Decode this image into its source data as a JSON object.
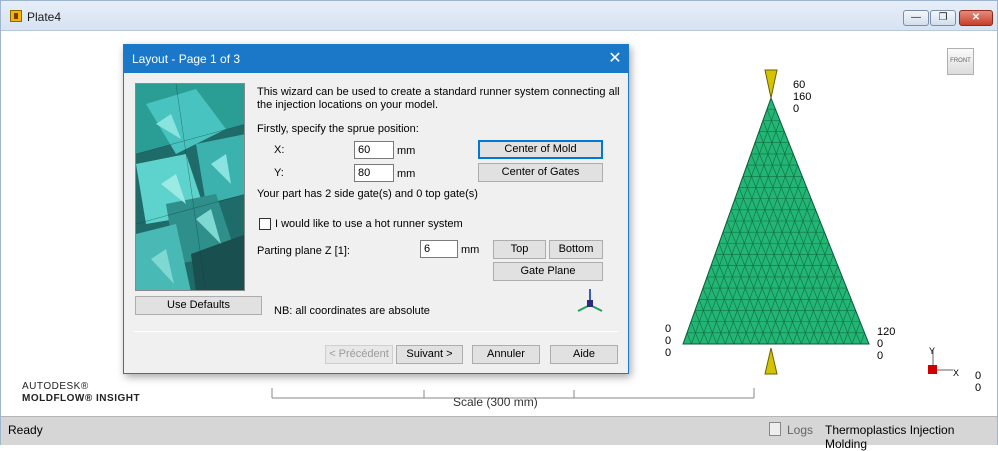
{
  "app": {
    "window_title": "Plate4",
    "brand_line1": "AUTODESK®",
    "brand_line2": "MOLDFLOW® INSIGHT"
  },
  "viewport": {
    "view_cube_label": "FRONT",
    "scale_label": "Scale (300 mm)",
    "top_label": {
      "a": "60",
      "b": "160",
      "c": "0"
    },
    "bottom_left_label": {
      "a": "0",
      "b": "0",
      "c": "0"
    },
    "bottom_right_label": {
      "a": "120",
      "b": "0",
      "c": "0"
    },
    "axis_labels": {
      "y": "Y",
      "x": "X"
    },
    "corner_values": {
      "a": "0",
      "b": "0"
    },
    "mesh_color": "#22b573"
  },
  "status": {
    "ready": "Ready",
    "logs": "Logs",
    "module": "Thermoplastics Injection Molding"
  },
  "dialog": {
    "title": "Layout - Page 1 of 3",
    "intro_line1": "This wizard can be used to create a standard runner system connecting all",
    "intro_line2": "the injection locations on your model.",
    "sprue_prompt": "Firstly, specify the sprue position:",
    "x_label": "X:",
    "x_value": "60",
    "x_unit": "mm",
    "y_label": "Y:",
    "y_value": "80",
    "y_unit": "mm",
    "center_of_mold": "Center of Mold",
    "center_of_gates": "Center of Gates",
    "gate_info": "Your part has 2 side gate(s) and 0 top gate(s)",
    "hot_runner_label": "I would like to use a hot runner system",
    "hot_runner_checked": false,
    "parting_label": "Parting plane Z [1]:",
    "parting_value": "6",
    "parting_unit": "mm",
    "top_btn": "Top",
    "bottom_btn": "Bottom",
    "gate_plane_btn": "Gate Plane",
    "use_defaults": "Use Defaults",
    "note": "NB: all coordinates are absolute",
    "prev_btn": "< Précédent",
    "next_btn": "Suivant >",
    "cancel_btn": "Annuler",
    "help_btn": "Aide"
  }
}
